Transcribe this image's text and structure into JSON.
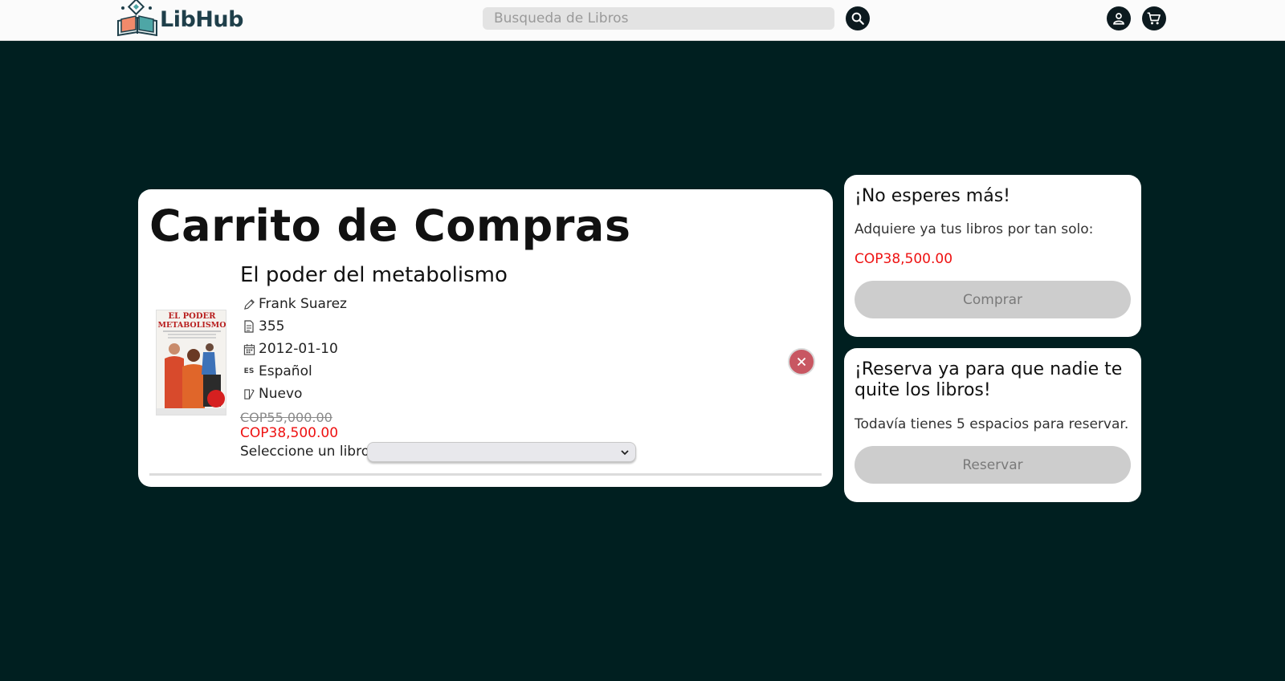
{
  "header": {
    "brand": "LibHub",
    "search_placeholder": "Busqueda de Libros",
    "icons": [
      "search-icon",
      "user-icon",
      "cart-icon"
    ]
  },
  "cart": {
    "title": "Carrito de Compras",
    "item": {
      "title": "El poder del metabolismo",
      "author": "Frank Suarez",
      "pages": "355",
      "date": "2012-01-10",
      "language_code": "ES",
      "language": "Español",
      "condition": "Nuevo",
      "old_price": "COP55,000.00",
      "price": "COP38,500.00",
      "select_label": "Seleccione un libro:",
      "select_value": "",
      "cover_text": {
        "line1": "EL PODER",
        "line2": "METABOLISMO"
      }
    }
  },
  "buy_panel": {
    "title": "¡No esperes más!",
    "text": "Adquiere ya tus libros por tan solo:",
    "price": "COP38,500.00",
    "button": "Comprar"
  },
  "reserve_panel": {
    "title": "¡Reserva ya para que nadie te quite los libros!",
    "text": "Todavía tienes 5 espacios para reservar.",
    "button": "Reservar"
  },
  "colors": {
    "background": "#001f20",
    "accent_price": "#ee1111",
    "remove_button": "#c85762",
    "disabled_button": "#cdcdcd"
  }
}
